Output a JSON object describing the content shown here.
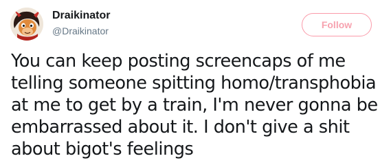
{
  "colors": {
    "text": "#14171a",
    "handle": "#657786",
    "follow_accent": "#f7a2af"
  },
  "user": {
    "display_name": "Draikinator",
    "handle": "@Draikinator",
    "avatar_icon": "cartoon-dragon-avatar-icon"
  },
  "follow_button": {
    "label": "Follow"
  },
  "tweet": {
    "lines": [
      "You can keep posting screencaps of me",
      "telling someone spitting homo/transphobia",
      "at me to get by a train, I'm never gonna be",
      "embarrassed about it. I don't give a shit",
      "about bigot's feelings"
    ]
  }
}
